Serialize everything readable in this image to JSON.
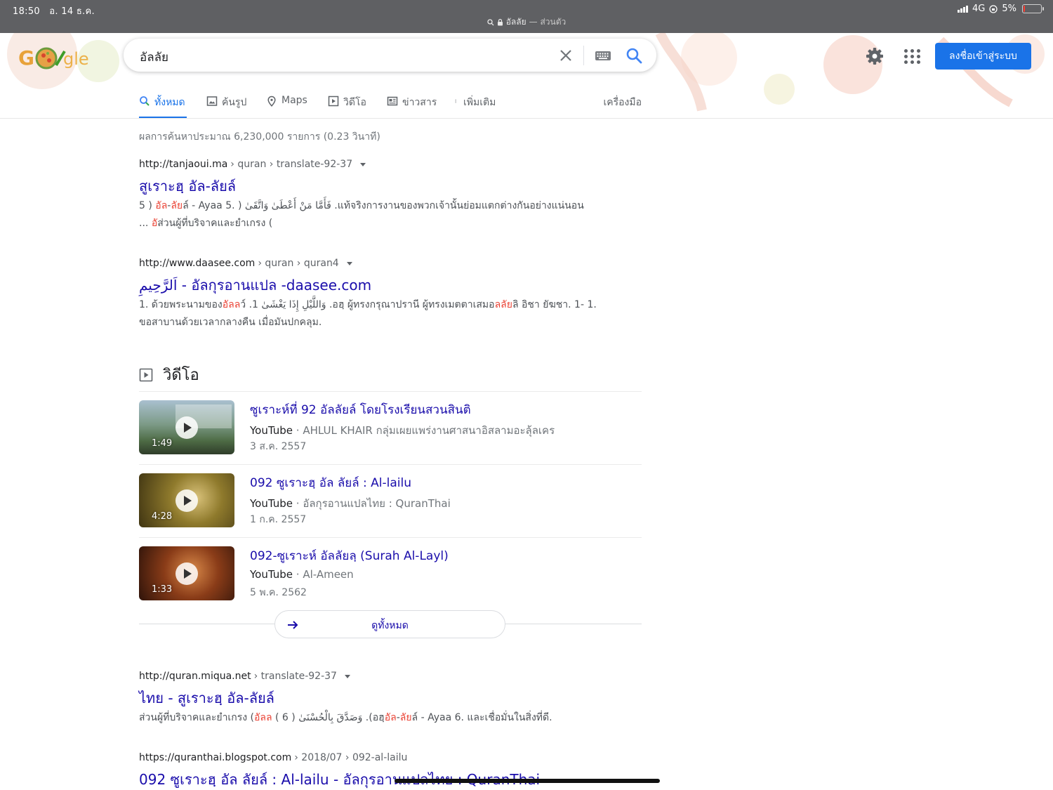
{
  "status_bar": {
    "time": "18:50",
    "date": "อ. 14 ธ.ค.",
    "network": "4G",
    "battery": "5%",
    "url_title": "อัลลัย",
    "url_subtitle": "— ส่วนตัว"
  },
  "header": {
    "search_query": "อัลลัย",
    "signin_label": "ลงชื่อเข้าสู่ระบบ",
    "tabs": [
      {
        "label": "ทั้งหมด",
        "icon": "search-icon",
        "active": true
      },
      {
        "label": "ค้นรูป",
        "icon": "image-icon",
        "active": false
      },
      {
        "label": "Maps",
        "icon": "map-pin-icon",
        "active": false
      },
      {
        "label": "วิดีโอ",
        "icon": "video-icon",
        "active": false
      },
      {
        "label": "ข่าวสาร",
        "icon": "news-icon",
        "active": false
      },
      {
        "label": "เพิ่มเติม",
        "icon": "more-vert-icon",
        "active": false
      }
    ],
    "tools_label": "เครื่องมือ"
  },
  "results_stats": "ผลการค้นหาประมาณ 6,230,000 รายการ (0.23 วินาที)",
  "results": [
    {
      "url_host": "http://tanjaoui.ma",
      "url_path": "› quran › translate-92-37",
      "title": "สูเราะฮฺ อัล-ลัยล์",
      "snippet_line1": [
        {
          "t": "5 ) ",
          "hl": false
        },
        {
          "t": "อัล",
          "hl": true
        },
        {
          "t": "-",
          "hl": false
        },
        {
          "t": "ลัย",
          "hl": true
        },
        {
          "t": "ล์ - Ayaa 5. ) فَأَمَّا مَنْ أَعْطَىٰ وَاتَّقَىٰ .แท้จริงการงานของพวกเจ้านั้นย่อมแตกต่างกันอย่างแน่นอน",
          "hl": false
        }
      ],
      "snippet_line2": [
        {
          "t": "... ",
          "hl": false
        },
        {
          "t": "อั",
          "hl": true
        },
        {
          "t": "ส่วนผู้ที่บริจาคและยำเกรง (",
          "hl": false
        }
      ]
    },
    {
      "url_host": "http://www.daasee.com",
      "url_path": "› quran › quran4",
      "title": "اَلرَّحِيمِ - อัลกุรอานแปล -daasee.com",
      "snippet_line1": [
        {
          "t": "1. ด้วยพระนามของ",
          "hl": false
        },
        {
          "t": "อัลล",
          "hl": true
        },
        {
          "t": "ว์ .1 وَاللَّيْلِ إِذَا يَغْشَىٰ .อฮฺ ผู้ทรงกรุณาปรานี ผู้ทรงเมตตาเสมอ",
          "hl": false
        },
        {
          "t": "ลลัย",
          "hl": true
        },
        {
          "t": "ลิ อิชา ยัฆชา. 1- 1.",
          "hl": false
        }
      ],
      "snippet_line2": [
        {
          "t": "ขอสาบานด้วยเวลากลางคืน เมื่อมันปกคลุม.",
          "hl": false
        }
      ]
    }
  ],
  "videos": {
    "heading": "วิดีโอ",
    "items": [
      {
        "title": "ซูเราะห์ที่ 92 อัลลัยล์ โดยโรงเรียนสวนสินติ",
        "source": "YouTube",
        "channel": "· AHLUL KHAIR กลุ่มเผยแพร่งานศาสนาอิสลามอะลุ้ลเคร",
        "date": "3 ส.ค. 2557",
        "duration": "1:49",
        "thumb_color": "#6f8c6e"
      },
      {
        "title": "092 ซูเราะฮฺ อัล ลัยล์ : Al-lailu",
        "source": "YouTube",
        "channel": "· อัลกุรอานแปลไทย : QuranThai",
        "date": "1 ก.ค. 2557",
        "duration": "4:28",
        "thumb_color": "#8a7a2c"
      },
      {
        "title": "092-ซูเราะห์ อัลลัยลฺ (Surah Al-Layl)",
        "source": "YouTube",
        "channel": "· Al-Ameen",
        "date": "5 พ.ค. 2562",
        "duration": "1:33",
        "thumb_color": "#7a3a1c"
      }
    ],
    "view_all_label": "ดูทั้งหมด"
  },
  "results_more": [
    {
      "url_host": "http://quran.miqua.net",
      "url_path": "› translate-92-37",
      "title": "ไทย - สูเราะฮฺ อัล-ลัยล์",
      "snippet_line1": [
        {
          "t": "ส่วนผู้ที่บริจาคและยำเกรง (",
          "hl": false
        },
        {
          "t": "อัลล",
          "hl": true
        },
        {
          "t": " ( 6 ) وَصَدَّقَ بِالْحُسْنَىٰ .(อฮฺ",
          "hl": false
        },
        {
          "t": "อัล",
          "hl": true
        },
        {
          "t": "-",
          "hl": false
        },
        {
          "t": "ลัย",
          "hl": true
        },
        {
          "t": "ล์ - Ayaa 6. และเชื่อมั่นในสิ่งที่ดี.",
          "hl": false
        }
      ]
    },
    {
      "url_host": "https://quranthai.blogspot.com",
      "url_path": "› 2018/07 › 092-al-lailu",
      "title": "092 ซูเราะฮฺ อัล ลัยล์ : Al-lailu - อัลกุรอานแปลไทย : QuranThai"
    }
  ],
  "colors": {
    "link": "#1a0dab",
    "accent": "#1a73e8",
    "highlight": "#ea4335",
    "status_bar": "#5f6063"
  }
}
